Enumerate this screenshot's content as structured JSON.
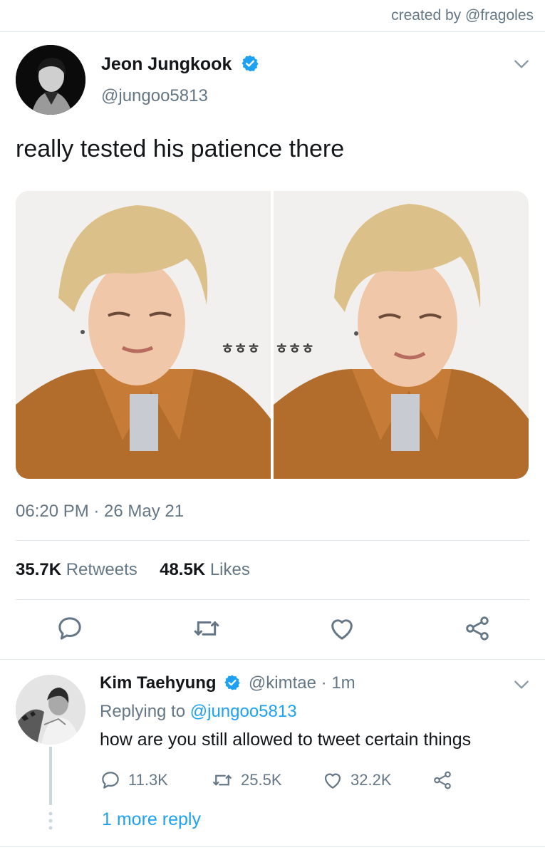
{
  "credit": "created by @fragoles",
  "main_tweet": {
    "display_name": "Jeon Jungkook",
    "handle": "@jungoo5813",
    "text": "really tested his patience there",
    "image_overlay_left": "ㅎㅎㅎ",
    "image_overlay_right": "ㅎㅎㅎ",
    "timestamp": "06:20 PM · 26 May 21",
    "retweets_count": "35.7K",
    "retweets_label": "Retweets",
    "likes_count": "48.5K",
    "likes_label": "Likes",
    "actions": [
      "reply-icon",
      "retweet-icon",
      "like-icon",
      "share-icon"
    ]
  },
  "reply_tweet": {
    "display_name": "Kim Taehyung",
    "handle": "@kimtae",
    "time": "· 1m",
    "replying_prefix": "Replying to",
    "replying_to": "@jungoo5813",
    "text": "how are you still allowed to tweet certain things",
    "reply_count": "11.3K",
    "retweet_count": "25.5K",
    "like_count": "32.2K",
    "more_replies": "1 more reply"
  },
  "colors": {
    "accent": "#1da1f2",
    "muted": "#657786",
    "divider": "#e1e8ed",
    "text": "#14171a"
  }
}
